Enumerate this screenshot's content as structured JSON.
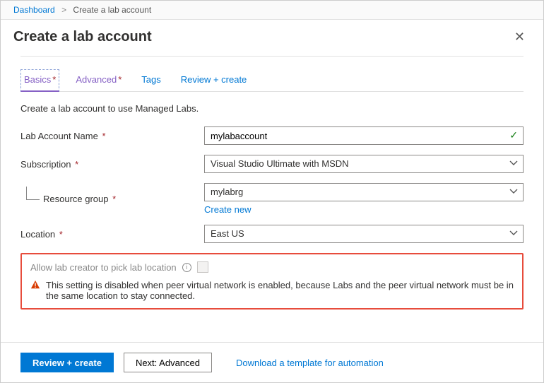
{
  "breadcrumb": {
    "dashboard": "Dashboard",
    "current": "Create a lab account"
  },
  "header": {
    "title": "Create a lab account"
  },
  "tabs": {
    "basics": "Basics",
    "advanced": "Advanced",
    "tags": "Tags",
    "review": "Review + create"
  },
  "intro": "Create a lab account to use Managed Labs.",
  "fields": {
    "name_label": "Lab Account Name",
    "name_value": "mylabaccount",
    "sub_label": "Subscription",
    "sub_value": "Visual Studio Ultimate with MSDN",
    "rg_label": "Resource group",
    "rg_value": "mylabrg",
    "create_new": "Create new",
    "loc_label": "Location",
    "loc_value": "East US"
  },
  "pick": {
    "label": "Allow lab creator to pick lab location",
    "warning": "This setting is disabled when peer virtual network is enabled, because Labs and the peer virtual network must be in the same location to stay connected."
  },
  "footer": {
    "review": "Review + create",
    "next": "Next: Advanced",
    "download": "Download a template for automation"
  }
}
